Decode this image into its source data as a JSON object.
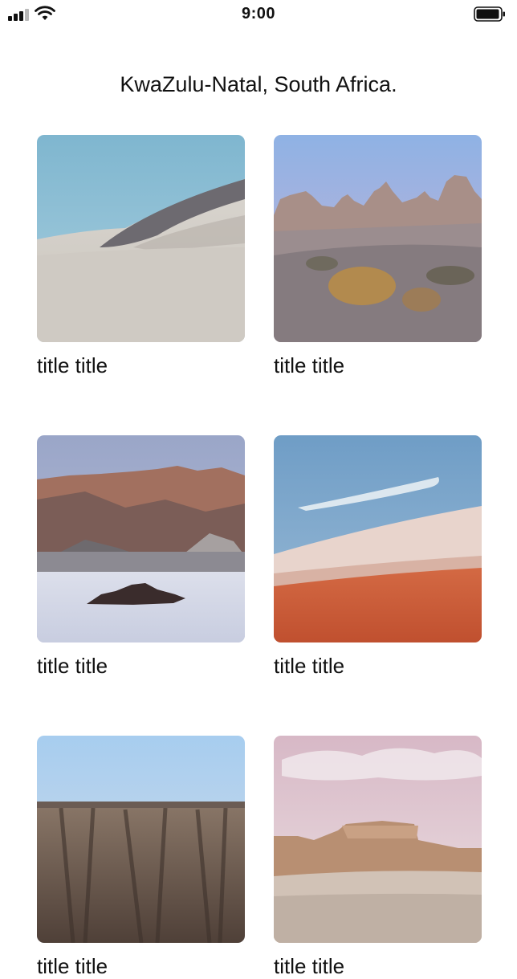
{
  "status_bar": {
    "time": "9:00",
    "signal_icon": "cellular-signal-icon",
    "wifi_icon": "wifi-icon",
    "battery_icon": "battery-icon"
  },
  "page": {
    "title": "KwaZulu-Natal, South Africa."
  },
  "gallery": {
    "items": [
      {
        "title": "title title",
        "image": "sand-dunes"
      },
      {
        "title": "title title",
        "image": "rock-spires-desert"
      },
      {
        "title": "title title",
        "image": "mountains-salt-flat"
      },
      {
        "title": "title title",
        "image": "red-desert-hill"
      },
      {
        "title": "title title",
        "image": "canyon-cliffs"
      },
      {
        "title": "title title",
        "image": "eroded-badlands"
      }
    ]
  }
}
